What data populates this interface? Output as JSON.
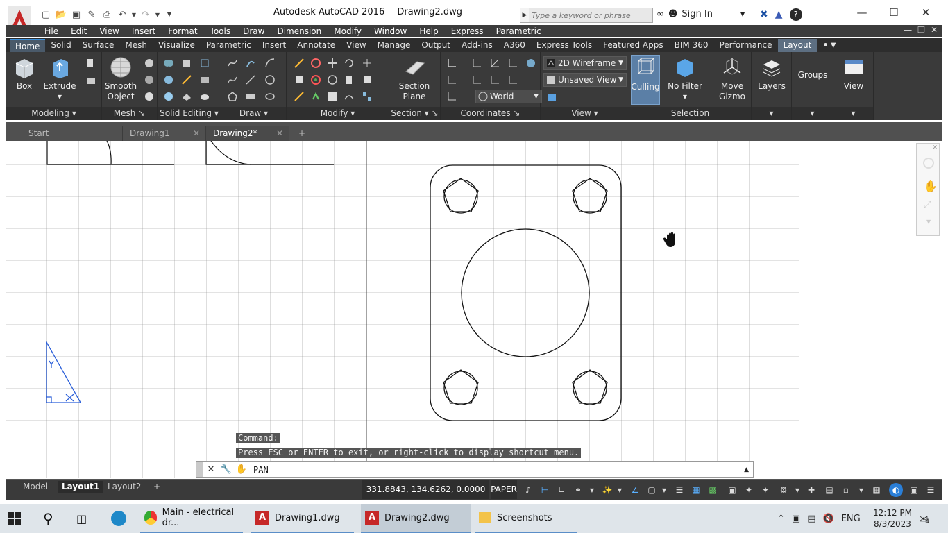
{
  "titlebar": {
    "app": "Autodesk AutoCAD 2016",
    "doc": "Drawing2.dwg",
    "search_placeholder": "Type a keyword or phrase",
    "signin": "Sign In"
  },
  "menu": [
    "File",
    "Edit",
    "View",
    "Insert",
    "Format",
    "Tools",
    "Draw",
    "Dimension",
    "Modify",
    "Window",
    "Help",
    "Express",
    "Parametric"
  ],
  "ribbon_tabs": [
    "Home",
    "Solid",
    "Surface",
    "Mesh",
    "Visualize",
    "Parametric",
    "Insert",
    "Annotate",
    "View",
    "Manage",
    "Output",
    "Add-ins",
    "A360",
    "Express Tools",
    "Featured Apps",
    "BIM 360",
    "Performance",
    "Layout"
  ],
  "ribbon": {
    "box": "Box",
    "extrude": "Extrude",
    "smooth1": "Smooth",
    "smooth2": "Object",
    "section_plane1": "Section",
    "section_plane2": "Plane",
    "visual_style": "2D Wireframe",
    "view_name": "Unsaved View",
    "ucs": "World",
    "culling": "Culling",
    "nofilter": "No Filter",
    "gizmo1": "Move",
    "gizmo2": "Gizmo",
    "layers": "Layers",
    "groups": "Groups",
    "view": "View",
    "panels": {
      "modeling": "Modeling",
      "mesh": "Mesh",
      "solid_editing": "Solid Editing",
      "draw": "Draw",
      "modify": "Modify",
      "section": "Section",
      "coordinates": "Coordinates",
      "view": "View",
      "selection": "Selection"
    }
  },
  "file_tabs": [
    {
      "label": "Start"
    },
    {
      "label": "Drawing1"
    },
    {
      "label": "Drawing2*"
    }
  ],
  "command": {
    "hist1": "Command:",
    "hist2": "Press ESC or ENTER to exit, or right-click to display shortcut menu.",
    "current": "PAN"
  },
  "layout_tabs": [
    "Model",
    "Layout1",
    "Layout2"
  ],
  "status": {
    "coords": "331.8843, 134.6262, 0.0000",
    "space": "PAPER"
  },
  "taskbar": {
    "items": [
      "Main - electrical dr...",
      "Drawing1.dwg",
      "Drawing2.dwg",
      "Screenshots"
    ],
    "lang": "ENG",
    "time": "12:12 PM",
    "date": "8/3/2023",
    "notif": "4"
  }
}
